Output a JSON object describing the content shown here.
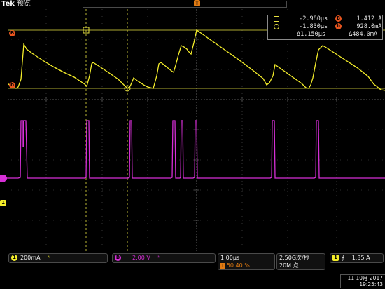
{
  "brand": {
    "name": "Tek",
    "mode": "预览"
  },
  "trigger_marker": "T",
  "readouts": {
    "row1": {
      "left_value": "-2.980µs",
      "right_channel": "B",
      "right_value": "1.412 A"
    },
    "row2": {
      "left_value": "-1.830µs",
      "right_channel": "b",
      "right_value": "928.0mA"
    },
    "row3": {
      "left_value": "Δ1.150µs",
      "right_value": "Δ484.0mA"
    }
  },
  "side_markers": {
    "ch_b_upper": "B",
    "ch_b_lower": "b",
    "ch1_ground": "1"
  },
  "bottom": {
    "ch1": {
      "badge": "1",
      "scale": "200mA",
      "coupling": "ᴺ"
    },
    "ch_b": {
      "badge": "B",
      "scale": "2.00 V",
      "coupling": "ᴺ"
    },
    "time": {
      "scale": "1.00µs",
      "trigger_icon": "T",
      "position": "50.40 %"
    },
    "acq": {
      "rate": "2.50G次/秒",
      "length": "20M 点"
    },
    "trigger": {
      "badge": "1",
      "edge": "⨍",
      "level": "1.35 A"
    },
    "date": "11 10月 2017",
    "time_of_day": "19:25:43"
  },
  "colors": {
    "ch1": "#f5ee2a",
    "ch_b": "#d62fd6",
    "trigger": "#e07a12",
    "grid": "#5a5a5a"
  }
}
